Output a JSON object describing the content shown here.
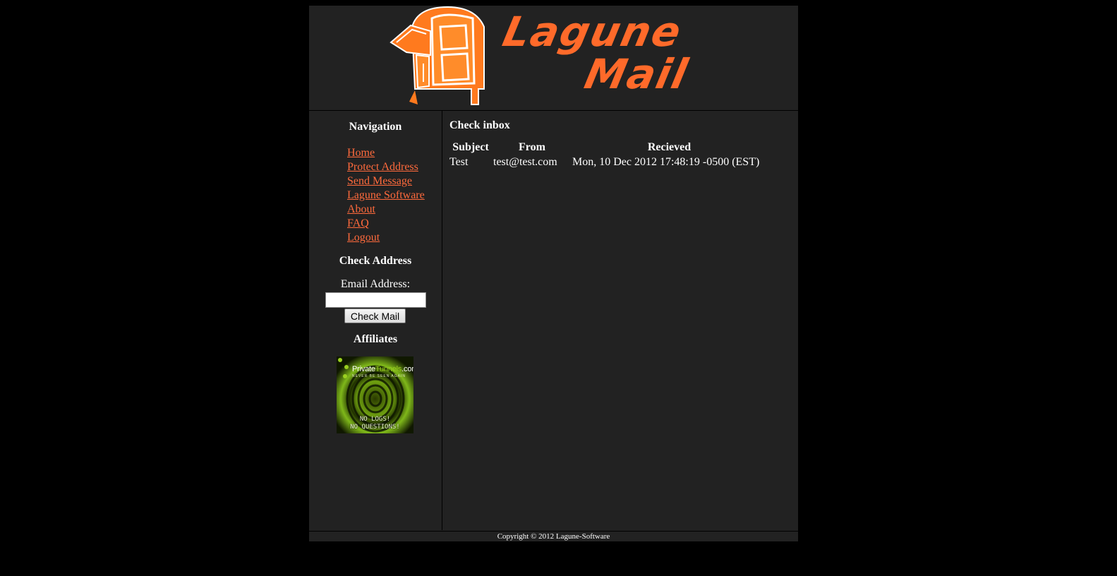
{
  "header": {
    "logo_word_1": "Lagune",
    "logo_word_2": "Mail"
  },
  "sidebar": {
    "navigation_heading": "Navigation",
    "nav_items": [
      {
        "label": "Home"
      },
      {
        "label": "Protect Address"
      },
      {
        "label": "Send Message"
      },
      {
        "label": "Lagune Software"
      },
      {
        "label": "About"
      },
      {
        "label": "FAQ"
      },
      {
        "label": "Logout"
      }
    ],
    "check_address_heading": "Check Address",
    "email_label": "Email Address:",
    "email_value": "",
    "check_button_label": "Check Mail",
    "affiliates_heading": "Affiliates",
    "affiliate": {
      "brand_part_1": "Private",
      "brand_part_2": "Tunnels",
      "brand_part_3": ".com",
      "tagline": "NEVER BE SEEN AGAIN",
      "slogan_1": "NO LOGS!",
      "slogan_2": "NO QUESTIONS!"
    }
  },
  "main": {
    "title": "Check inbox",
    "columns": [
      "Subject",
      "From",
      "Recieved"
    ],
    "rows": [
      {
        "subject": "Test",
        "from": "test@test.com",
        "received": "Mon, 10 Dec 2012 17:48:19 -0500 (EST)"
      }
    ]
  },
  "footer": {
    "copyright": "Copyright © 2012 Lagune-Software"
  },
  "colors": {
    "background": "#000000",
    "panel": "#222222",
    "link": "#ff6a3c",
    "brand_orange": "#ff6a2a"
  }
}
